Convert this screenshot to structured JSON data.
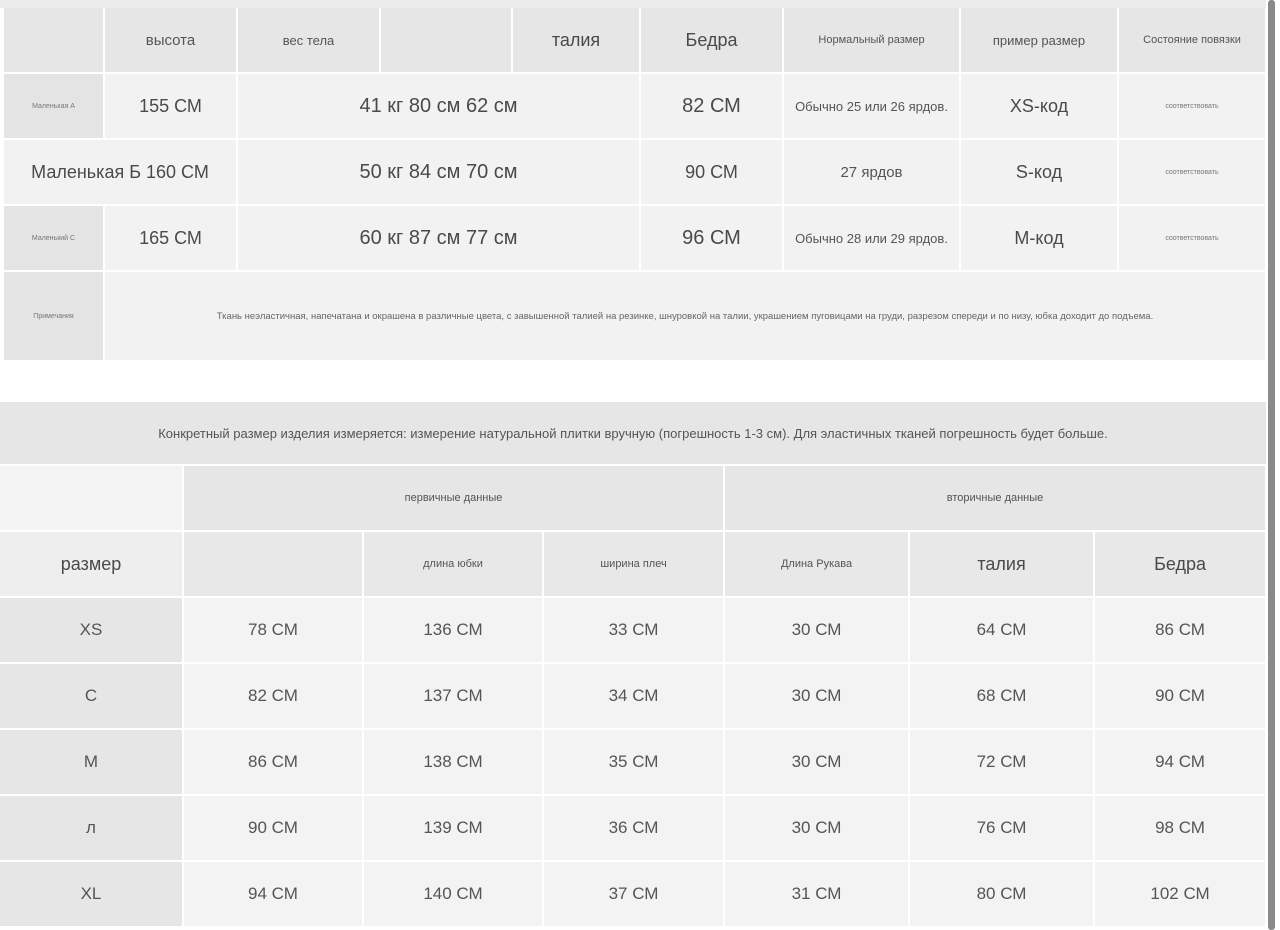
{
  "table1": {
    "headers": [
      "",
      "высота",
      "вес тела",
      "",
      "талия",
      "Бедра",
      "Нормальный размер",
      "пример размер",
      "Состояние повязки"
    ],
    "rows": [
      {
        "label": "Маленькая А",
        "height": "155 СМ",
        "wbw": "41 кг 80 см 62 см",
        "hips": "82 СМ",
        "normal": "Обычно 25 или 26 ярдов.",
        "example": "XS-код",
        "status": "соответствовать"
      },
      {
        "merged": "Маленькая Б 160 СМ",
        "wbw": "50 кг 84 см 70 см",
        "hips": "90 СМ",
        "normal": "27 ярдов",
        "example": "S-код",
        "status": "соответствовать"
      },
      {
        "label": "Маленький С",
        "height": "165 СМ",
        "wbw": "60 кг 87 см 77 см",
        "hips": "96 СМ",
        "normal": "Обычно 28 или 29 ярдов.",
        "example": "М-код",
        "status": "соответствовать"
      }
    ],
    "note_label": "Примечания",
    "note_text": "Ткань неэластичная, напечатана и окрашена в различные цвета, с завышенной талией на резинке, шнуровкой на талии, украшением пуговицами на груди, разрезом спереди и по низу, юбка доходит до подъема."
  },
  "banner": "Конкретный размер изделия измеряется: измерение натуральной плитки вручную (погрешность 1-3 см). Для эластичных тканей погрешность будет больше.",
  "table2": {
    "group_primary": "первичные данные",
    "group_secondary": "вторичные данные",
    "headers": [
      "размер",
      "",
      "длина юбки",
      "ширина плеч",
      "Длина Рукава",
      "талия",
      "Бедра"
    ],
    "rows": [
      [
        "XS",
        "78 СМ",
        "136 СМ",
        "33 СМ",
        "30 СМ",
        "64 СМ",
        "86 СМ"
      ],
      [
        "С",
        "82 СМ",
        "137 СМ",
        "34 СМ",
        "30 СМ",
        "68 СМ",
        "90 СМ"
      ],
      [
        "М",
        "86 СМ",
        "138 СМ",
        "35 СМ",
        "30 СМ",
        "72 СМ",
        "94 СМ"
      ],
      [
        "л",
        "90 СМ",
        "139 СМ",
        "36 СМ",
        "30 СМ",
        "76 СМ",
        "98 СМ"
      ],
      [
        "XL",
        "94 СМ",
        "140 СМ",
        "37 СМ",
        "31 СМ",
        "80 СМ",
        "102 СМ"
      ]
    ]
  }
}
